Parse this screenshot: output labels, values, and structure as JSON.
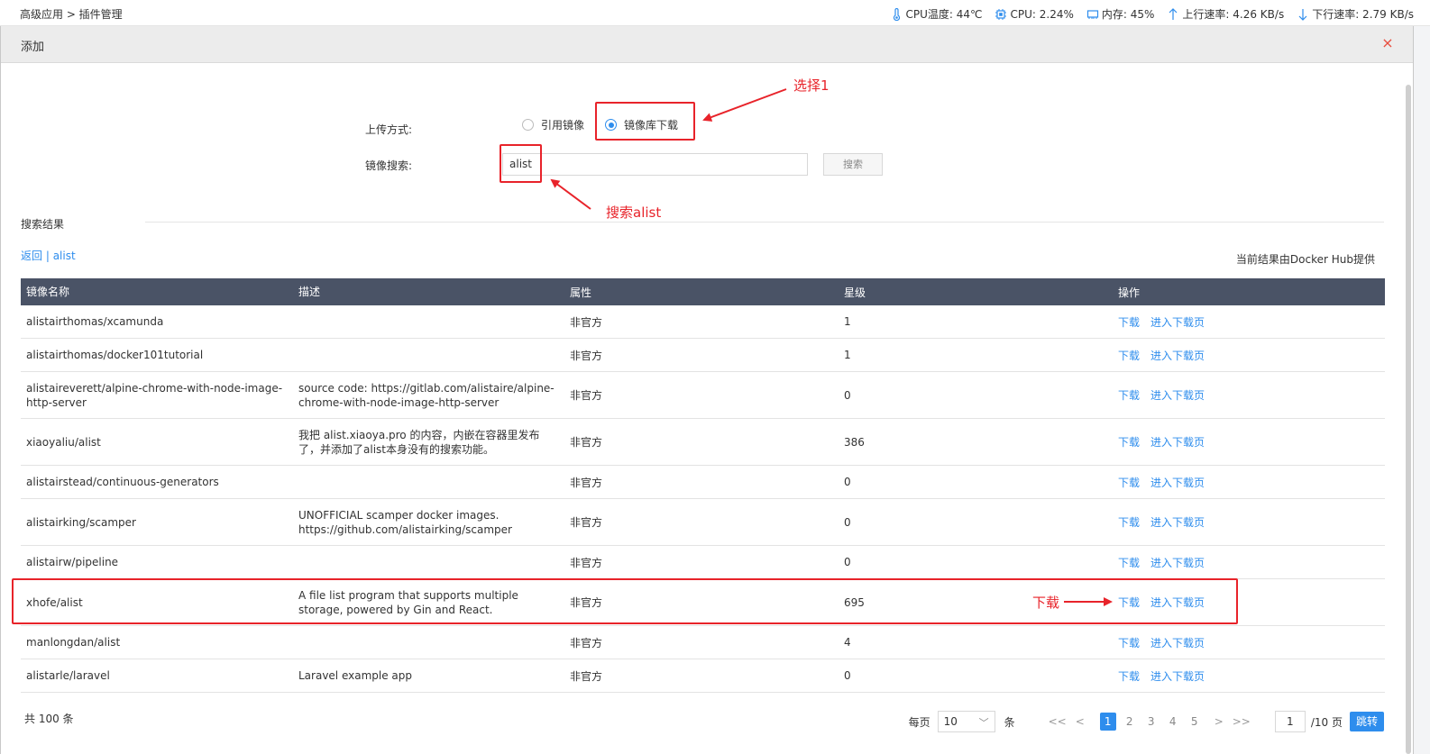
{
  "breadcrumb": "高级应用 > 插件管理",
  "stats": {
    "cpu_temp": "CPU温度: 44℃",
    "cpu": "CPU: 2.24%",
    "memory": "内存: 45%",
    "upload": "上行速率: 4.26 KB/s",
    "download": "下行速率: 2.79 KB/s"
  },
  "dialog": {
    "title": "添加",
    "close": "×"
  },
  "form": {
    "upload_label": "上传方式:",
    "option_ref": "引用镜像",
    "option_repo": "镜像库下载",
    "selected": "option_repo",
    "search_label": "镜像搜索:",
    "search_value": "alist",
    "search_button": "搜索"
  },
  "results": {
    "title": "搜索结果",
    "back": "返回",
    "separator": " | ",
    "query": "alist",
    "provider": "当前结果由Docker Hub提供"
  },
  "table": {
    "headers": [
      "镜像名称",
      "描述",
      "属性",
      "星级",
      "操作"
    ],
    "action_download": "下载",
    "action_page": "进入下载页",
    "rows": [
      {
        "name": "alistairthomas/xcamunda",
        "desc": "",
        "attr": "非官方",
        "stars": "1"
      },
      {
        "name": "alistairthomas/docker101tutorial",
        "desc": "",
        "attr": "非官方",
        "stars": "1"
      },
      {
        "name": "alistaireverett/alpine-chrome-with-node-image-http-server",
        "desc": "source code: https://gitlab.com/alistaire/alpine-chrome-with-node-image-http-server",
        "attr": "非官方",
        "stars": "0"
      },
      {
        "name": "xiaoyaliu/alist",
        "desc": "我把 alist.xiaoya.pro 的内容，内嵌在容器里发布了，并添加了alist本身没有的搜索功能。",
        "attr": "非官方",
        "stars": "386"
      },
      {
        "name": "alistairstead/continuous-generators",
        "desc": "",
        "attr": "非官方",
        "stars": "0"
      },
      {
        "name": "alistairking/scamper",
        "desc": "UNOFFICIAL scamper docker images. https://github.com/alistairking/scamper",
        "attr": "非官方",
        "stars": "0"
      },
      {
        "name": "alistairw/pipeline",
        "desc": "",
        "attr": "非官方",
        "stars": "0"
      },
      {
        "name": "xhofe/alist",
        "desc": "A file list program that supports multiple storage, powered by Gin and React.",
        "attr": "非官方",
        "stars": "695"
      },
      {
        "name": "manlongdan/alist",
        "desc": "",
        "attr": "非官方",
        "stars": "4"
      },
      {
        "name": "alistarle/laravel",
        "desc": "Laravel example app",
        "attr": "非官方",
        "stars": "0"
      }
    ]
  },
  "pagination": {
    "total": "共 100 条",
    "per_page_label": "每页",
    "per_page_value": "10",
    "per_page_unit": "条",
    "first": "<<",
    "prev": "<",
    "pages": [
      "1",
      "2",
      "3",
      "4",
      "5"
    ],
    "current": "1",
    "next": ">",
    "last": ">>",
    "goto_value": "1",
    "total_pages": "/10 页",
    "goto_button": "跳转"
  },
  "annotations": {
    "select": "选择1",
    "search": "搜索alist",
    "download": "下载",
    "color": "#e8232a"
  },
  "colors": {
    "accent": "#2e8ded",
    "table_header": "#4a5366",
    "close": "#e84c3d"
  }
}
